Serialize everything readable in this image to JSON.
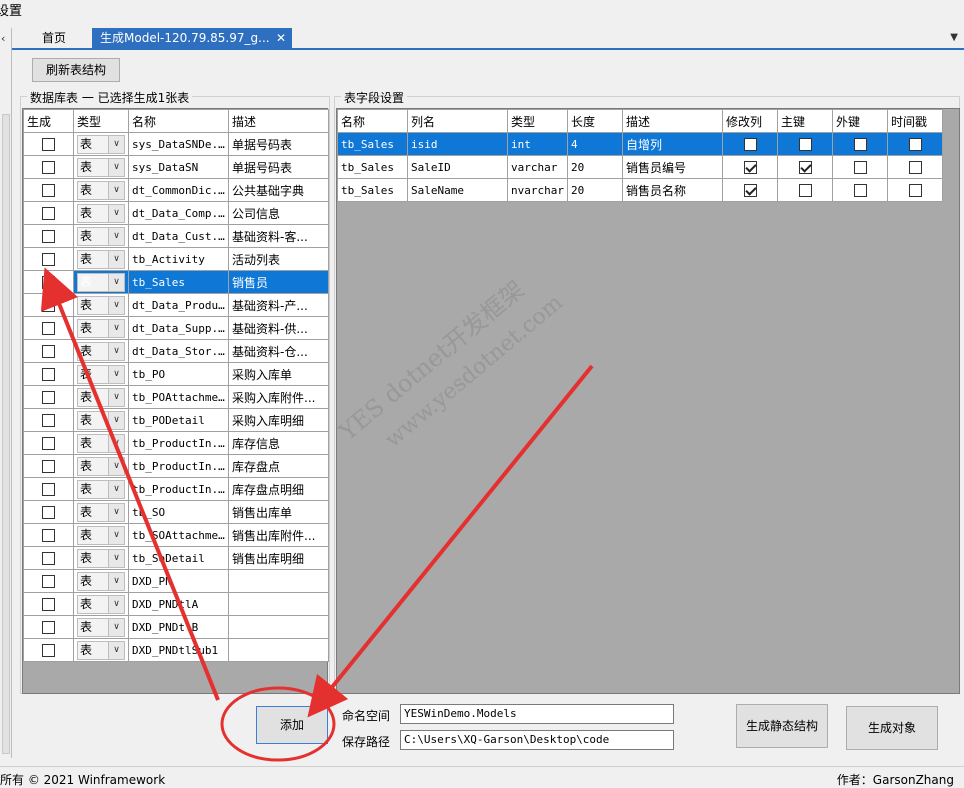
{
  "window_title": "设置",
  "tabs": [
    {
      "label": "首页"
    },
    {
      "label": "生成Model-120.79.85.97_g..."
    }
  ],
  "icons": {
    "close": "close-icon",
    "dropdown": "chevron-down-icon"
  },
  "toolbar": {
    "refresh_label": "刷新表结构"
  },
  "left_panel": {
    "title": "数据库表 一 已选择生成1张表",
    "columns": [
      "生成",
      "类型",
      "名称",
      "描述"
    ],
    "rows": [
      {
        "checked": false,
        "type": "表",
        "name": "sys_DataSNDe...",
        "desc": "单据号码表"
      },
      {
        "checked": false,
        "type": "表",
        "name": "sys_DataSN",
        "desc": "单据号码表"
      },
      {
        "checked": false,
        "type": "表",
        "name": "dt_CommonDic...",
        "desc": "公共基础字典"
      },
      {
        "checked": false,
        "type": "表",
        "name": "dt_Data_Comp...",
        "desc": "公司信息"
      },
      {
        "checked": false,
        "type": "表",
        "name": "dt_Data_Cust...",
        "desc": "基础资料-客..."
      },
      {
        "checked": false,
        "type": "表",
        "name": "tb_Activity",
        "desc": "活动列表"
      },
      {
        "checked": true,
        "type": "表",
        "name": "tb_Sales",
        "desc": "销售员",
        "selected": true
      },
      {
        "checked": false,
        "type": "表",
        "name": "dt_Data_Product",
        "desc": "基础资料-产..."
      },
      {
        "checked": false,
        "type": "表",
        "name": "dt_Data_Supp...",
        "desc": "基础资料-供..."
      },
      {
        "checked": false,
        "type": "表",
        "name": "dt_Data_Stor...",
        "desc": "基础资料-仓..."
      },
      {
        "checked": false,
        "type": "表",
        "name": "tb_PO",
        "desc": "采购入库单"
      },
      {
        "checked": false,
        "type": "表",
        "name": "tb_POAttachment",
        "desc": "采购入库附件..."
      },
      {
        "checked": false,
        "type": "表",
        "name": "tb_PODetail",
        "desc": "采购入库明细"
      },
      {
        "checked": false,
        "type": "表",
        "name": "tb_ProductIn...",
        "desc": "库存信息"
      },
      {
        "checked": false,
        "type": "表",
        "name": "tb_ProductIn...",
        "desc": "库存盘点"
      },
      {
        "checked": false,
        "type": "表",
        "name": "tb_ProductIn...",
        "desc": "库存盘点明细"
      },
      {
        "checked": false,
        "type": "表",
        "name": "tb_SO",
        "desc": "销售出库单"
      },
      {
        "checked": false,
        "type": "表",
        "name": "tb_SOAttachment",
        "desc": "销售出库附件..."
      },
      {
        "checked": false,
        "type": "表",
        "name": "tb_SoDetail",
        "desc": "销售出库明细"
      },
      {
        "checked": false,
        "type": "表",
        "name": "DXD_PN",
        "desc": ""
      },
      {
        "checked": false,
        "type": "表",
        "name": "DXD_PNDtlA",
        "desc": ""
      },
      {
        "checked": false,
        "type": "表",
        "name": "DXD_PNDtlB",
        "desc": ""
      },
      {
        "checked": false,
        "type": "表",
        "name": "DXD_PNDtlSub1",
        "desc": ""
      }
    ]
  },
  "right_panel": {
    "title": "表字段设置",
    "columns": [
      "名称",
      "列名",
      "类型",
      "长度",
      "描述",
      "修改列",
      "主键",
      "外键",
      "时间戳"
    ],
    "rows": [
      {
        "table": "tb_Sales",
        "column": "isid",
        "type": "int",
        "length": "4",
        "desc": "自增列",
        "modify": false,
        "pk": false,
        "fk": false,
        "ts": false,
        "selected": true
      },
      {
        "table": "tb_Sales",
        "column": "SaleID",
        "type": "varchar",
        "length": "20",
        "desc": "销售员编号",
        "modify": true,
        "pk": true,
        "fk": false,
        "ts": false
      },
      {
        "table": "tb_Sales",
        "column": "SaleName",
        "type": "nvarchar",
        "length": "20",
        "desc": "销售员名称",
        "modify": true,
        "pk": false,
        "fk": false,
        "ts": false
      }
    ]
  },
  "bottom": {
    "add_label": "添加",
    "namespace_label": "命名空间",
    "namespace_value": "YESWinDemo.Models",
    "path_label": "保存路径",
    "path_value": "C:\\Users\\XQ-Garson\\Desktop\\code",
    "gen_static_label": "生成静态结构",
    "gen_object_label": "生成对象"
  },
  "watermark": {
    "line1": "YES dotnet开发框架",
    "line2": "www.yesdotnet.com"
  },
  "status": {
    "left": "所有 © 2021 Winframework",
    "right": "作者：GarsonZhang"
  },
  "colors": {
    "accent": "#2f6fc0",
    "selection": "#0f78d7",
    "annotation": "#e53030"
  }
}
